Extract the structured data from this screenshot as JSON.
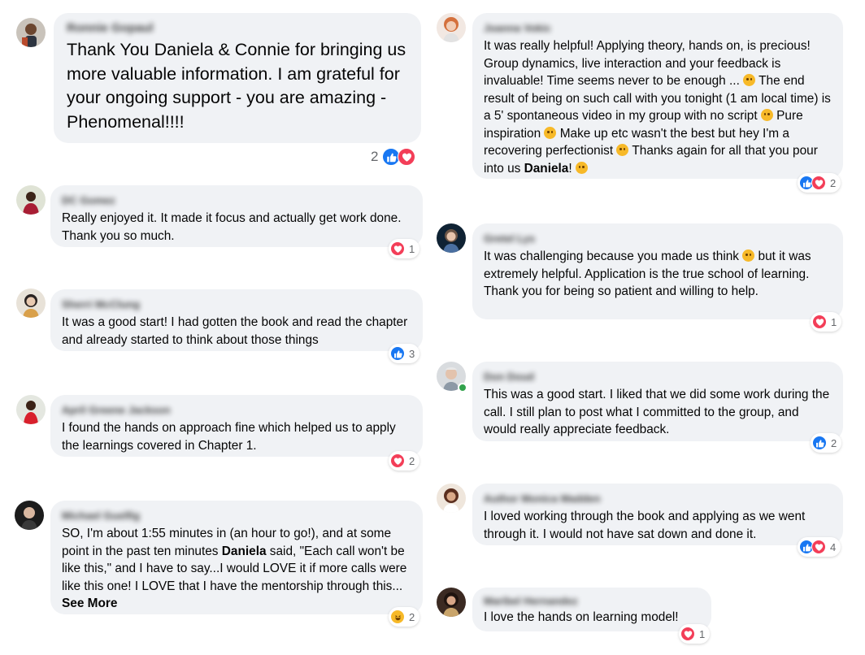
{
  "colors": {
    "bubble_bg": "#f0f2f5",
    "like": "#1877f2",
    "love": "#f33e58",
    "haha": "#f7b928",
    "online": "#31a24c"
  },
  "comments": [
    {
      "name": "Ronnie Gopaul",
      "text": "Thank You Daniela & Connie for bringing us more valuable information. I am grateful for your ongoing support - you are amazing - Phenomenal!!!!",
      "reaction_count": "2",
      "reaction_icons": [
        "like-icon",
        "love-icon"
      ]
    },
    {
      "name": "DC Gomez",
      "text": "Really enjoyed it. It made it focus and actually get work done. Thank you so much.",
      "reaction_count": "1",
      "reaction_icons": [
        "love-icon"
      ]
    },
    {
      "name": "Sherri McClung",
      "text": "It was a good start! I had gotten the book and read the chapter and already started to think about those things",
      "reaction_count": "3",
      "reaction_icons": [
        "like-icon"
      ]
    },
    {
      "name": "April Greene Jackson",
      "text": "I found the hands on approach fine which helped us to apply the learnings covered in Chapter 1.",
      "reaction_count": "2",
      "reaction_icons": [
        "love-icon"
      ]
    },
    {
      "name": "Michael Guelfig",
      "text_before": "SO, I'm about 1:55 minutes in (an hour to go!), and at some point in the past ten minutes ",
      "text_bold": "Daniela",
      "text_after": " said, \"Each call won't be like this,\" and I have to say...I would LOVE it if more calls were like this one! I LOVE that I have the mentorship through this... ",
      "see_more": "See More",
      "reaction_count": "2",
      "reaction_icons": [
        "haha-icon"
      ]
    },
    {
      "name": "Joanna Vokic",
      "text_p1": "It was really helpful! Applying theory, hands on, is precious! Group dynamics, live interaction and your feedback is invaluable! Time seems never to be enough ... ",
      "text_p2": " The end result of being on such call with you tonight (1 am local time) is a 5' spontaneous video in my group with no script ",
      "text_p3": " Pure inspiration ",
      "text_p4": " Make up etc wasn't the best but hey I'm a recovering perfectionist ",
      "text_p5": " Thanks again for all that you pour into us ",
      "text_bold": "Daniela",
      "text_p6": "! ",
      "reaction_count": "2",
      "reaction_icons": [
        "like-icon",
        "love-icon"
      ]
    },
    {
      "name": "Gretel Lys",
      "text_before": "It was challenging because you made us think ",
      "text_after": " but it was extremely helpful. Application is the true school of learning. Thank you for being so patient and willing to help.",
      "reaction_count": "1",
      "reaction_icons": [
        "love-icon"
      ]
    },
    {
      "name": "Don Doud",
      "text": "This was a good start. I liked that we did some work during the call. I still plan to post what I committed to the group, and would really appreciate feedback.",
      "reaction_count": "2",
      "reaction_icons": [
        "like-icon"
      ]
    },
    {
      "name": "Author Monica Madden",
      "text": "I loved working through the book and applying as we went through it. I would not have sat down and done it.",
      "reaction_count": "4",
      "reaction_icons": [
        "like-icon",
        "love-icon"
      ]
    },
    {
      "name": "Maribel Hernandez",
      "text": "I love the hands on learning model!",
      "reaction_count": "1",
      "reaction_icons": [
        "love-icon"
      ]
    }
  ]
}
